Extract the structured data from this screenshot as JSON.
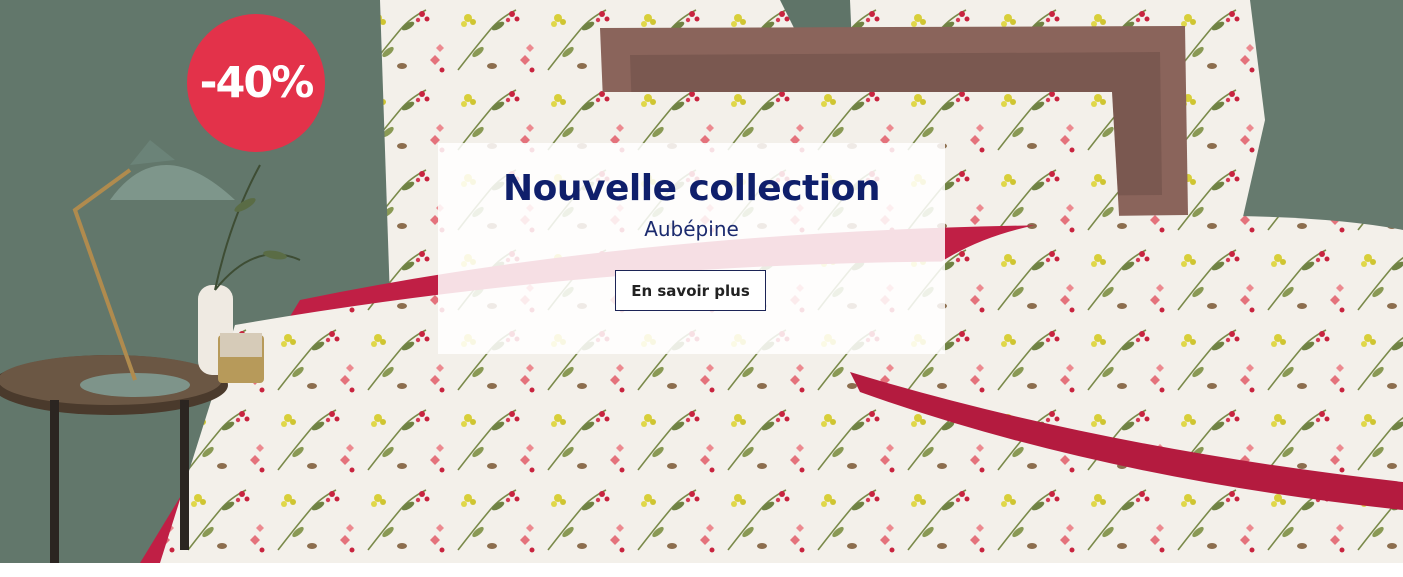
{
  "hero": {
    "badge": "-40%",
    "title": "Nouvelle collection",
    "subtitle": "Aubépine",
    "cta_label": "En savoir plus"
  },
  "colors": {
    "badge_bg": "#e3324a",
    "title": "#0f1f6b",
    "wall": "#5f7468",
    "duvet_accent": "#c01f45"
  }
}
